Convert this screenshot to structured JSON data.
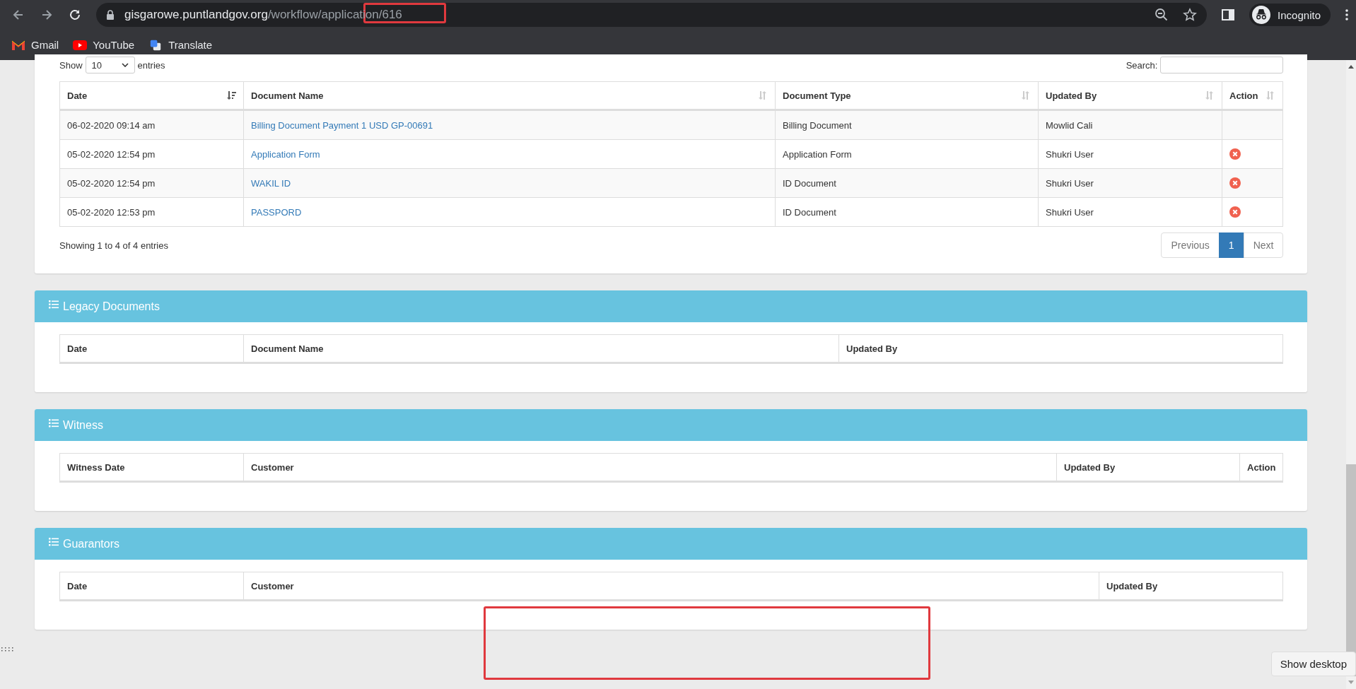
{
  "browser": {
    "url_host": "gisgarowe.puntlandgov.org",
    "url_path": "/workflow/application/616",
    "profile": "Incognito",
    "bookmarks": [
      {
        "label": "Gmail",
        "kind": "mail"
      },
      {
        "label": "YouTube",
        "kind": "video"
      },
      {
        "label": "Translate",
        "kind": "translate"
      }
    ]
  },
  "documents": {
    "show_label": "Show",
    "page_length": "10",
    "entries_label": "entries",
    "search_label": "Search:",
    "columns": [
      {
        "label": "Date",
        "sorted": true
      },
      {
        "label": "Document Name",
        "sorted": false
      },
      {
        "label": "Document Type",
        "sorted": false
      },
      {
        "label": "Updated By",
        "sorted": false
      },
      {
        "label": "Action",
        "sorted": false
      }
    ],
    "rows": [
      {
        "date": "06-02-2020 09:14 am",
        "name": "Billing Document Payment 1 USD GP-00691",
        "type": "Billing Document",
        "updated_by": "Mowlid Cali",
        "deletable": false
      },
      {
        "date": "05-02-2020 12:54 pm",
        "name": "Application Form",
        "type": "Application Form",
        "updated_by": "Shukri User",
        "deletable": true
      },
      {
        "date": "05-02-2020 12:54 pm",
        "name": "WAKIL ID",
        "type": "ID Document",
        "updated_by": "Shukri User",
        "deletable": true
      },
      {
        "date": "05-02-2020 12:53 pm",
        "name": "PASSPORD",
        "type": "ID Document",
        "updated_by": "Shukri User",
        "deletable": true
      }
    ],
    "info": "Showing 1 to 4 of 4 entries",
    "pagination": [
      {
        "label": "Previous",
        "selected": false
      },
      {
        "label": "1",
        "selected": true
      },
      {
        "label": "Next",
        "selected": false
      }
    ]
  },
  "sections": [
    {
      "title": "Legacy Documents",
      "columns": [
        "Date",
        "Document Name",
        "Updated By"
      ]
    },
    {
      "title": "Witness",
      "columns": [
        "Witness Date",
        "Customer",
        "Updated By",
        "Action"
      ]
    },
    {
      "title": "Guarantors",
      "columns": [
        "Date",
        "Customer",
        "Updated By"
      ]
    }
  ],
  "taskbar_tooltip": "Show desktop"
}
